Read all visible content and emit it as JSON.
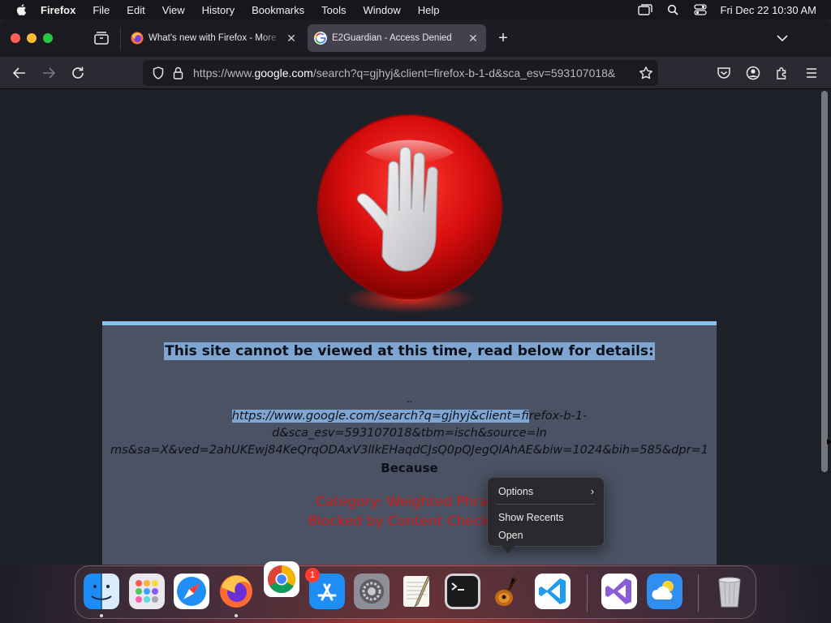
{
  "menubar": {
    "app_name": "Firefox",
    "items": [
      "File",
      "Edit",
      "View",
      "History",
      "Bookmarks",
      "Tools",
      "Window",
      "Help"
    ],
    "clock": "Fri Dec 22  10:30 AM",
    "status_icons": [
      "screen-mirroring-icon",
      "spotlight-search-icon",
      "control-center-icon"
    ]
  },
  "browser": {
    "tabs": [
      {
        "title": "What's new with Firefox - More",
        "favicon": "firefox-icon",
        "active": false
      },
      {
        "title": "E2Guardian - Access Denied",
        "favicon": "google-icon",
        "active": true
      }
    ],
    "url": {
      "prefix": "https://www.",
      "domain": "google.com",
      "rest": "/search?q=gjhyj&client=firefox-b-1-d&sca_esv=593107018&"
    }
  },
  "page": {
    "headline": "This site cannot be viewed at this time, read below for details:",
    "dashes": "--",
    "blocked_url_highlighted": "https://www.google.com/search?q=gjhyj&client=fi",
    "blocked_url_rest": "refox-b-1-d&sca_esv=593107018&tbm=isch&source=ln\nms&sa=X&ved=2ahUKEwj84KeQrqODAxV3lIkEHaqdCJsQ0pQJegQIAhAE&biw=1024&bih=585&dpr=1",
    "because": "Because",
    "reason_line1": "Category: Weighted Phrase",
    "reason_line2": "Blocked by Content Checking"
  },
  "context_menu": {
    "items": [
      "Options",
      "Show Recents",
      "Open"
    ]
  },
  "dock": {
    "apps": [
      "Finder",
      "Launchpad",
      "Safari",
      "Firefox",
      "Google Chrome",
      "App Store",
      "System Settings",
      "TextEdit",
      "Terminal",
      "GarageBand",
      "Visual Studio Code",
      "Visual Studio",
      "Weather",
      "Trash"
    ],
    "settings_badge": "1"
  }
}
